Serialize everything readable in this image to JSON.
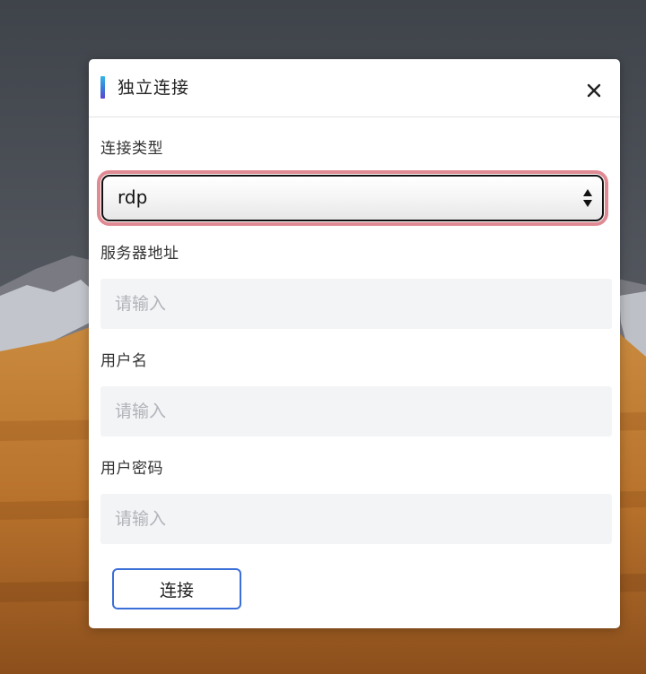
{
  "dialog": {
    "title": "独立连接",
    "close_icon": "close-icon"
  },
  "form": {
    "connection_type": {
      "label": "连接类型",
      "selected": "rdp"
    },
    "server_address": {
      "label": "服务器地址",
      "value": "",
      "placeholder": "请输入"
    },
    "username": {
      "label": "用户名",
      "value": "",
      "placeholder": "请输入"
    },
    "password": {
      "label": "用户密码",
      "value": "",
      "placeholder": "请输入"
    },
    "submit_label": "连接"
  },
  "colors": {
    "focus_ring": "#e08a93",
    "button_border": "#3b6fd8",
    "input_bg": "#f3f4f6",
    "title_accent_top": "#35b6e8",
    "title_accent_bottom": "#5c47cf"
  }
}
